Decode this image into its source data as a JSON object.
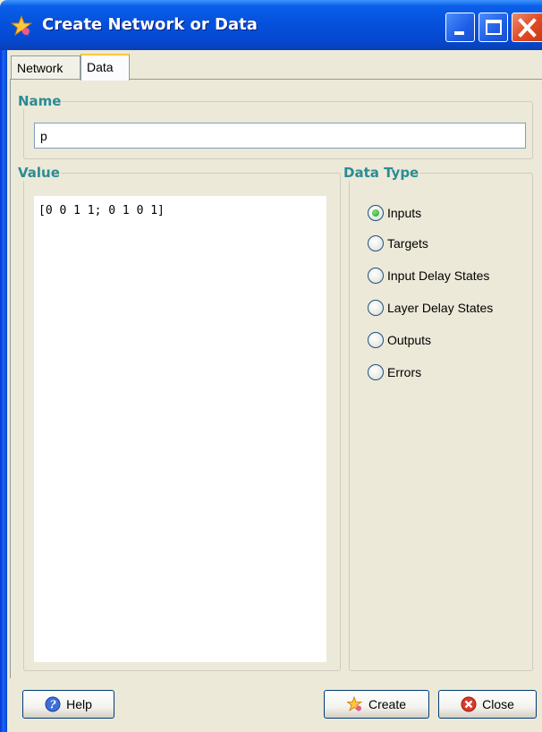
{
  "window": {
    "title": "Create Network or Data"
  },
  "tabs": [
    {
      "label": "Network"
    },
    {
      "label": "Data"
    }
  ],
  "name_section": {
    "legend": "Name",
    "value": "p"
  },
  "value_section": {
    "legend": "Value",
    "text": "[0 0 1 1; 0 1 0 1]"
  },
  "data_type": {
    "legend": "Data Type",
    "selected": "Inputs",
    "options": [
      {
        "label": "Inputs"
      },
      {
        "label": "Targets"
      },
      {
        "label": "Input Delay States"
      },
      {
        "label": "Layer Delay States"
      },
      {
        "label": "Outputs"
      },
      {
        "label": "Errors"
      }
    ]
  },
  "buttons": {
    "help": "Help",
    "create": "Create",
    "close": "Close"
  },
  "icons": {
    "title": "star-icon",
    "help": "help-icon",
    "create": "star-icon",
    "close": "close-icon"
  },
  "colors": {
    "legend": "#2a8c94",
    "titlebar": "#0553de",
    "selected_radio": "#21a121"
  }
}
